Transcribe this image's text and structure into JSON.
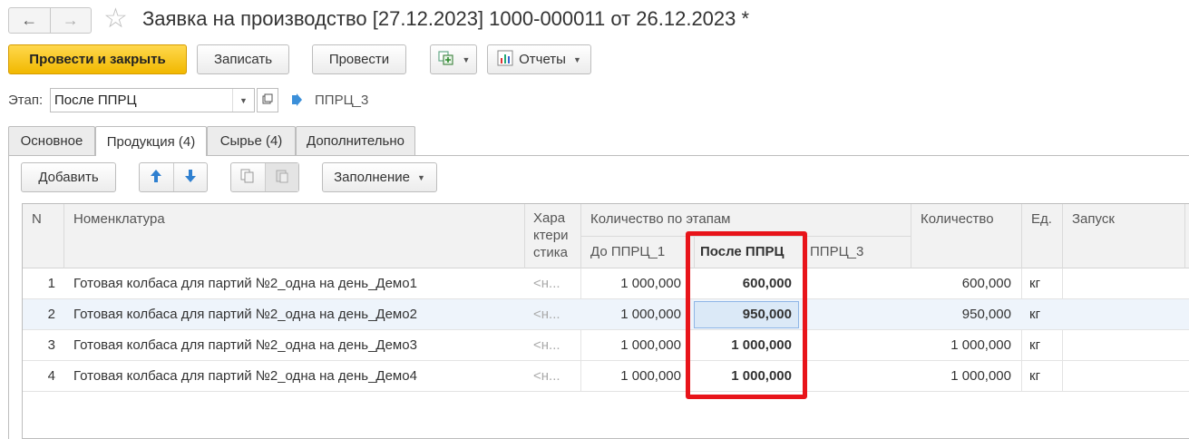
{
  "window": {
    "title": "Заявка на производство [27.12.2023] 1000-000011 от 26.12.2023 *",
    "back_icon": "←",
    "forward_icon": "→",
    "star_icon": "☆"
  },
  "toolbar": {
    "post_close_label": "Провести и закрыть",
    "save_label": "Записать",
    "post_label": "Провести",
    "reports_label": "Отчеты"
  },
  "stage": {
    "label": "Этап:",
    "value": "После ППРЦ",
    "next_stage": "ППРЦ_3"
  },
  "tabs": [
    {
      "label": "Основное"
    },
    {
      "label": "Продукция (4)"
    },
    {
      "label": "Сырье (4)"
    },
    {
      "label": "Дополнительно"
    }
  ],
  "subtoolbar": {
    "add_label": "Добавить",
    "fill_label": "Заполнение"
  },
  "table": {
    "headers": {
      "n": "N",
      "nomenclature": "Номенклатура",
      "characteristic": "Хара\nктери\nстика",
      "by_stages": "Количество по этапам",
      "before": "До ППРЦ_1",
      "after": "После ППРЦ",
      "pprc3": "ППРЦ_3",
      "quantity": "Количество",
      "unit": "Ед.",
      "launch": "Запуск"
    },
    "rows": [
      {
        "n": "1",
        "name": "Готовая колбаса для партий №2_одна на день_Демо1",
        "char": "<н...",
        "before": "1 000,000",
        "after": "600,000",
        "qty": "600,000",
        "unit": "кг"
      },
      {
        "n": "2",
        "name": "Готовая колбаса для партий №2_одна на день_Демо2",
        "char": "<н...",
        "before": "1 000,000",
        "after": "950,000",
        "qty": "950,000",
        "unit": "кг"
      },
      {
        "n": "3",
        "name": "Готовая колбаса для партий №2_одна на день_Демо3",
        "char": "<н...",
        "before": "1 000,000",
        "after": "1 000,000",
        "qty": "1 000,000",
        "unit": "кг"
      },
      {
        "n": "4",
        "name": "Готовая колбаса для партий №2_одна на день_Демо4",
        "char": "<н...",
        "before": "1 000,000",
        "after": "1 000,000",
        "qty": "1 000,000",
        "unit": "кг"
      }
    ]
  },
  "colors": {
    "primary_button": "#f1b800",
    "highlight_box": "#e8141a",
    "selected_row": "#eef4fb"
  }
}
